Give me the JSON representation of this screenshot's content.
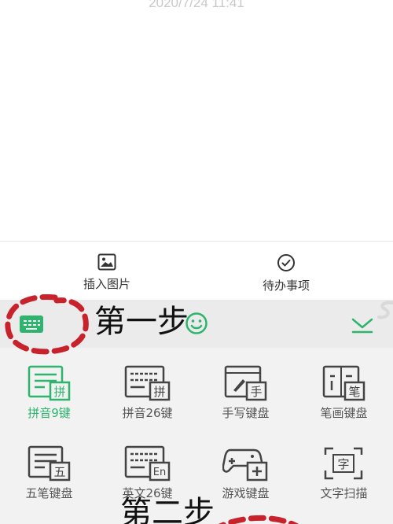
{
  "note": {
    "timestamp": "2020/7/24 11:41"
  },
  "action_bar": {
    "insert_image": "插入图片",
    "todo": "待办事项"
  },
  "keyboard_grid": {
    "items": [
      {
        "label": "拼音9键",
        "badge": "拼",
        "active": true
      },
      {
        "label": "拼音26键",
        "badge": "拼",
        "active": false
      },
      {
        "label": "手写键盘",
        "badge": "手",
        "active": false
      },
      {
        "label": "笔画键盘",
        "badge": "笔",
        "active": false
      },
      {
        "label": "五笔键盘",
        "badge": "五",
        "active": false
      },
      {
        "label": "英文26键",
        "badge": "En",
        "active": false
      },
      {
        "label": "游戏键盘",
        "badge": "",
        "active": false
      },
      {
        "label": "文字扫描",
        "badge": "字",
        "active": false
      }
    ]
  },
  "annotations": {
    "step1": "第一步",
    "step2": "第二步",
    "color": "#c8232c"
  },
  "colors": {
    "accent": "#2db56d",
    "toolbar_bg": "#ebebeb",
    "grid_bg": "#f2f2f2"
  }
}
